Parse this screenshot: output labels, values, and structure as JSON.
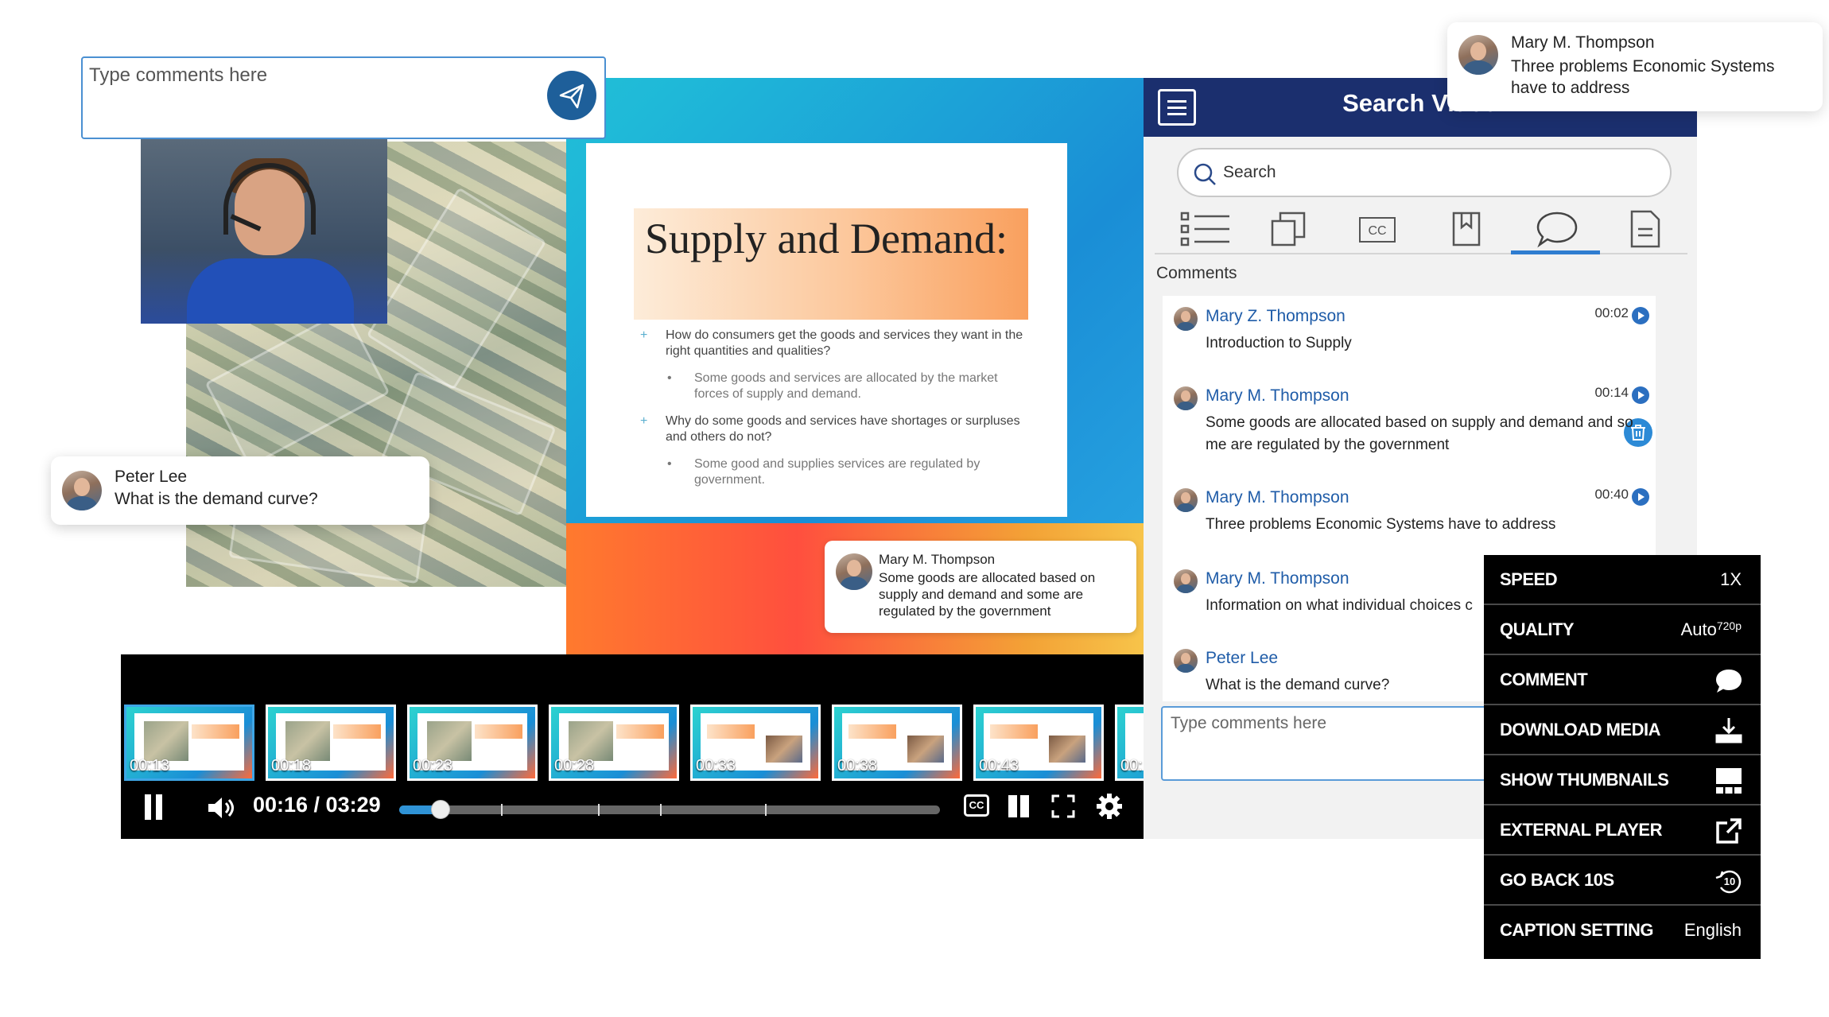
{
  "top_comment": {
    "placeholder": "Type comments here"
  },
  "slide": {
    "title": "Supply and Demand:",
    "q1": "How do consumers get the goods and services they want in the right quantities and qualities?",
    "a1": "Some goods and services are allocated by the market forces of supply and demand.",
    "q2": "Why do some goods and services have shortages or surpluses and others do not?",
    "a2": "Some good and supplies services are regulated by government."
  },
  "slide_comment": {
    "name": "Mary M. Thompson",
    "text": "Some goods are allocated based on supply and demand and some are regulated by the government"
  },
  "peter_card": {
    "name": "Peter Lee",
    "text": "What is the demand curve?"
  },
  "mary_card": {
    "name": "Mary M. Thompson",
    "text": "Three problems Economic Systems have to address"
  },
  "thumbnails": [
    "00:13",
    "00:18",
    "00:23",
    "00:28",
    "00:33",
    "00:38",
    "00:43",
    "00:"
  ],
  "player": {
    "time": "00:16 / 03:29",
    "progress": 0.077,
    "cc_label": "CC"
  },
  "sidebar": {
    "title": "Search Video",
    "search_placeholder": "Search",
    "tabs": [
      "list-icon",
      "copy-icon",
      "cc-icon",
      "bookmark-icon",
      "comments-icon",
      "document-icon"
    ],
    "active_tab": "comments",
    "comments_label": "Comments",
    "comments": [
      {
        "name": "Mary Z. Thompson",
        "time": "00:02",
        "text": "Introduction to Supply"
      },
      {
        "name": "Mary M. Thompson",
        "time": "00:14",
        "text": "Some goods are allocated based on supply and demand and so me are regulated by the government"
      },
      {
        "name": "Mary M. Thompson",
        "time": "00:40",
        "text": "Three problems Economic Systems have to address"
      },
      {
        "name": "Mary M. Thompson",
        "time": "",
        "text": "Information on what individual choices c"
      },
      {
        "name": "Peter Lee",
        "time": "",
        "text": "What is the demand curve?"
      }
    ],
    "comment_input_placeholder": "Type comments here"
  },
  "settings_menu": {
    "speed": {
      "label": "SPEED",
      "value": "1X"
    },
    "quality": {
      "label": "QUALITY",
      "value": "Auto",
      "sup": "720p"
    },
    "comment": {
      "label": "COMMENT"
    },
    "download": {
      "label": "DOWNLOAD MEDIA"
    },
    "thumbnails": {
      "label": "SHOW THUMBNAILS"
    },
    "external": {
      "label": "EXTERNAL PLAYER"
    },
    "go_back": {
      "label": "GO BACK 10S"
    },
    "caption": {
      "label": "CAPTION SETTING",
      "value": "English"
    }
  },
  "colors": {
    "brand_navy": "#1b2f6e",
    "accent_blue": "#2f93d6",
    "link_blue": "#1f5ca8"
  }
}
